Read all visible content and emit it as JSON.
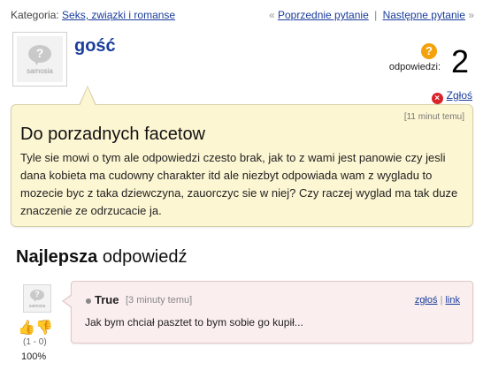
{
  "topbar": {
    "category_label": "Kategoria:",
    "category_link": "Seks, związki i romanse",
    "prev_arrow": "«",
    "prev_link": "Poprzednie pytanie",
    "separator": "|",
    "next_link": "Następne pytanie",
    "next_arrow": "»"
  },
  "question": {
    "avatar_logo_text": "samosia",
    "avatar_logo_mark": "?",
    "asker": "gość",
    "answers_label": "odpowiedzi:",
    "answers_count": "2",
    "answers_icon": "?",
    "report_label": "Zgłoś",
    "report_icon": "×",
    "time": "[11 minut temu]",
    "title": "Do porzadnych facetow",
    "body": "Tyle sie mowi o tym ale odpowiedzi czesto brak, jak to z wami jest panowie czy jesli dana kobieta ma cudowny charakter itd ale niezbyt odpowiada wam z wygladu to mozecie byc z taka dziewczyna, zauorczyc sie w niej? Czy raczej wyglad ma tak duze znaczenie ze odrzucacie ja."
  },
  "best_answer": {
    "heading_bold": "Najlepsza",
    "heading_rest": " odpowiedź",
    "avatar_logo_text": "samosia",
    "avatar_logo_mark": "?",
    "author": "True",
    "time": "[3 minuty temu]",
    "report_link": "zgłoś",
    "link_sep": "|",
    "link_link": "link",
    "text": "Jak bym chciał pasztet to bym sobie go kupił...",
    "vote_up_icon": "👍",
    "vote_down_icon": "👎",
    "tally": "(1 - 0)",
    "percent": "100%"
  },
  "colors": {
    "link": "#1a3d9c",
    "question_bg": "#fdf6d3",
    "answer_bg": "#fbeeee",
    "answers_icon": "#f3a20c",
    "report_icon": "#d9232a"
  }
}
